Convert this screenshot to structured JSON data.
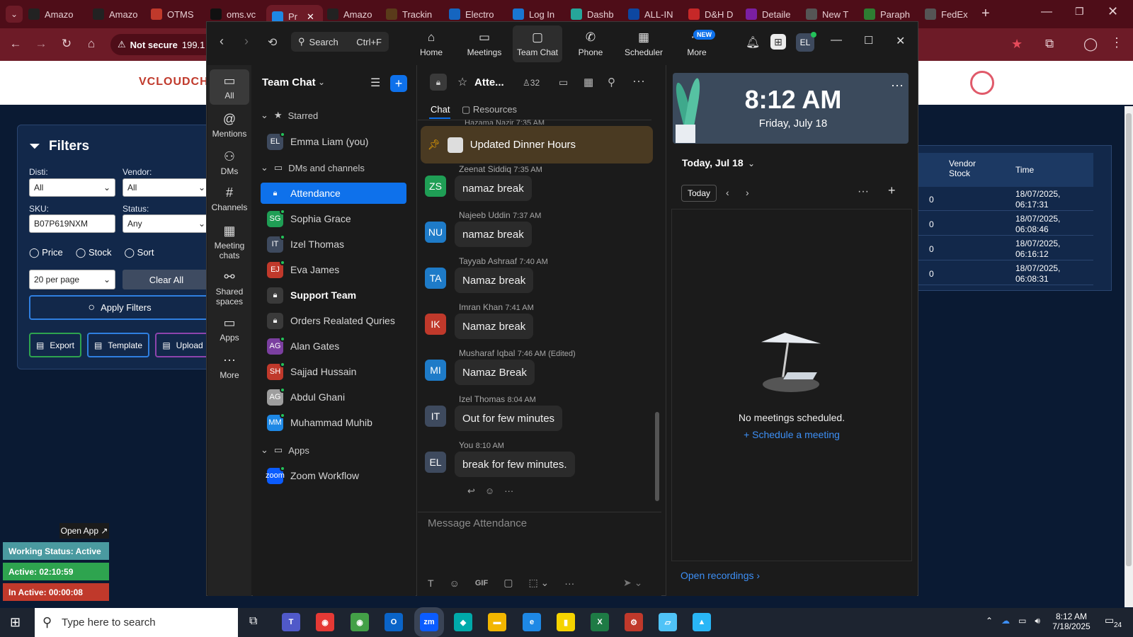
{
  "browser": {
    "tabs": [
      {
        "label": "Amazo",
        "icon": "amazon-icon",
        "color": "#222222"
      },
      {
        "label": "Amazo",
        "icon": "amazon-icon",
        "color": "#222222"
      },
      {
        "label": "OTMS",
        "icon": "otms-icon",
        "color": "#c0392b"
      },
      {
        "label": "oms.vc",
        "icon": "oms-icon",
        "color": "#111111"
      },
      {
        "label": "Pr",
        "icon": "s-icon",
        "color": "#1e88e5"
      },
      {
        "label": "Amazo",
        "icon": "amazon-icon",
        "color": "#222222"
      },
      {
        "label": "Trackin",
        "icon": "ups-icon",
        "color": "#5a3b1a"
      },
      {
        "label": "Electro",
        "icon": "ec-icon",
        "color": "#1565c0"
      },
      {
        "label": "Log In",
        "icon": "login-icon",
        "color": "#1976d2"
      },
      {
        "label": "Dashb",
        "icon": "dashboard-icon",
        "color": "#26a69a"
      },
      {
        "label": "ALL-IN",
        "icon": "all-in-icon",
        "color": "#0d47a1"
      },
      {
        "label": "D&H D",
        "icon": "dh-icon",
        "color": "#c62828"
      },
      {
        "label": "Detaile",
        "icon": "detail-icon",
        "color": "#7b1fa2"
      },
      {
        "label": "New T",
        "icon": "newtab-icon",
        "color": "#555555"
      },
      {
        "label": "Paraph",
        "icon": "paraph-icon",
        "color": "#2e7d32"
      },
      {
        "label": "FedEx",
        "icon": "fedex-icon",
        "color": "#555555"
      }
    ],
    "address_warning": "Not secure",
    "address_text": "199.1"
  },
  "webpage": {
    "logo_text": "VCLOUDCH",
    "filters": {
      "title": "Filters",
      "disti_label": "Disti:",
      "disti_value": "All",
      "vendor_label": "Vendor:",
      "vendor_value": "All",
      "sku_label": "SKU:",
      "sku_value": "B07P619NXM",
      "status_label": "Status:",
      "status_value": "Any",
      "radio_price": "Price",
      "radio_stock": "Stock",
      "radio_sort": "Sort",
      "per_page": "20 per page",
      "clear_all": "Clear All",
      "apply": "Apply Filters",
      "export": "Export",
      "template": "Template",
      "upload": "Upload"
    },
    "table": {
      "col_stock": "Vendor Stock",
      "col_time": "Time",
      "rows": [
        {
          "stock": "0",
          "time1": "18/07/2025,",
          "time2": "06:17:31"
        },
        {
          "stock": "0",
          "time1": "18/07/2025,",
          "time2": "06:08:46"
        },
        {
          "stock": "0",
          "time1": "18/07/2025,",
          "time2": "06:16:12"
        },
        {
          "stock": "0",
          "time1": "18/07/2025,",
          "time2": "06:08:31"
        }
      ]
    },
    "status_widget": {
      "open_app": "Open App ↗",
      "working": "Working Status: Active",
      "active": "Active: 02:10:59",
      "inactive": "In Active: 00:00:08"
    }
  },
  "zoom": {
    "search_label": "Search",
    "search_shortcut": "Ctrl+F",
    "toolbar": [
      {
        "label": "Home",
        "icon": "home-icon"
      },
      {
        "label": "Meetings",
        "icon": "video-camera-icon"
      },
      {
        "label": "Team Chat",
        "icon": "chat-icon"
      },
      {
        "label": "Phone",
        "icon": "phone-icon"
      },
      {
        "label": "Scheduler",
        "icon": "calendar-icon"
      },
      {
        "label": "More",
        "icon": "more-icon"
      }
    ],
    "new_badge": "NEW",
    "user_initials": "EL",
    "left_nav": [
      {
        "label": "All",
        "icon": "chat-bubble-icon"
      },
      {
        "label": "Mentions",
        "icon": "at-icon"
      },
      {
        "label": "DMs",
        "icon": "people-icon"
      },
      {
        "label": "Channels",
        "icon": "hash-icon"
      },
      {
        "label": "Meeting chats",
        "icon": "calendar-icon"
      },
      {
        "label": "Shared spaces",
        "icon": "share-icon"
      },
      {
        "label": "Apps",
        "icon": "apps-icon"
      },
      {
        "label": "More",
        "icon": "ellipsis-icon"
      }
    ],
    "list_title": "Team Chat",
    "section_starred": "Starred",
    "section_dms": "DMs and channels",
    "section_apps": "Apps",
    "starred": [
      {
        "initials": "EL",
        "name": "Emma Liam (you)",
        "color": "#3e4a5e"
      }
    ],
    "contacts": [
      {
        "initials": "",
        "name": "Attendance",
        "type": "lock",
        "color": "#0e71eb"
      },
      {
        "initials": "SG",
        "name": "Sophia Grace",
        "color": "#1f9e55"
      },
      {
        "initials": "IT",
        "name": "Izel Thomas",
        "color": "#3e4a5e"
      },
      {
        "initials": "EJ",
        "name": "Eva James",
        "color": "#c0392b"
      },
      {
        "initials": "",
        "name": "Support Team",
        "type": "lock",
        "color": "#3a3a3a"
      },
      {
        "initials": "",
        "name": "Orders Realated Quries",
        "type": "lock",
        "color": "#3a3a3a"
      },
      {
        "initials": "AG",
        "name": "Alan Gates",
        "color": "#7b3fa0"
      },
      {
        "initials": "SH",
        "name": "Sajjad Hussain",
        "color": "#c0392b"
      },
      {
        "initials": "AG",
        "name": "Abdul Ghani",
        "color": "#9e9e9e"
      },
      {
        "initials": "MM",
        "name": "Muhammad Muhib",
        "color": "#1e88e5"
      }
    ],
    "apps": [
      {
        "initials": "zoom",
        "name": "Zoom Workflow",
        "color": "#0b5cff"
      }
    ],
    "chat": {
      "channel": "Atte...",
      "members": "32",
      "tab_chat": "Chat",
      "tab_resources": "Resources",
      "pinned_prev": "Hazama Nazir 7:35 AM",
      "pinned": "Updated Dinner Hours",
      "messages": [
        {
          "initials": "ZS",
          "author": "Zeenat Siddiq",
          "time": "7:35 AM",
          "text": "namaz break",
          "color": "#1f9e55"
        },
        {
          "initials": "NU",
          "author": "Najeeb Uddin",
          "time": "7:37 AM",
          "text": "namaz break",
          "color": "#1e7bc8"
        },
        {
          "initials": "TA",
          "author": "Tayyab Ashraaf",
          "time": "7:40 AM",
          "text": "Namaz break",
          "color": "#1e7bc8"
        },
        {
          "initials": "IK",
          "author": "Imran Khan",
          "time": "7:41 AM",
          "text": "Namaz break",
          "color": "#c0392b"
        },
        {
          "initials": "MI",
          "author": "Musharaf Iqbal",
          "time": "7:46 AM (Edited)",
          "text": "Namaz Break",
          "color": "#1e7bc8"
        },
        {
          "initials": "IT",
          "author": "Izel Thomas",
          "time": "8:04 AM",
          "text": "Out for few minutes",
          "color": "#3e4a5e"
        },
        {
          "initials": "EL",
          "author": "You",
          "time": "8:10 AM",
          "text": "break for few minutes.",
          "color": "#3e4a5e"
        }
      ],
      "composer_placeholder": "Message Attendance",
      "gif": "GIF"
    },
    "calendar": {
      "clock": "8:12 AM",
      "date": "Friday, July 18",
      "today_label": "Today, Jul 18",
      "today_btn": "Today",
      "empty_text": "No meetings scheduled.",
      "schedule_link": "+ Schedule a meeting",
      "recordings": "Open recordings"
    }
  },
  "taskbar": {
    "search_placeholder": "Type here to search",
    "time": "8:12 AM",
    "date": "7/18/2025",
    "notifications": "24"
  }
}
